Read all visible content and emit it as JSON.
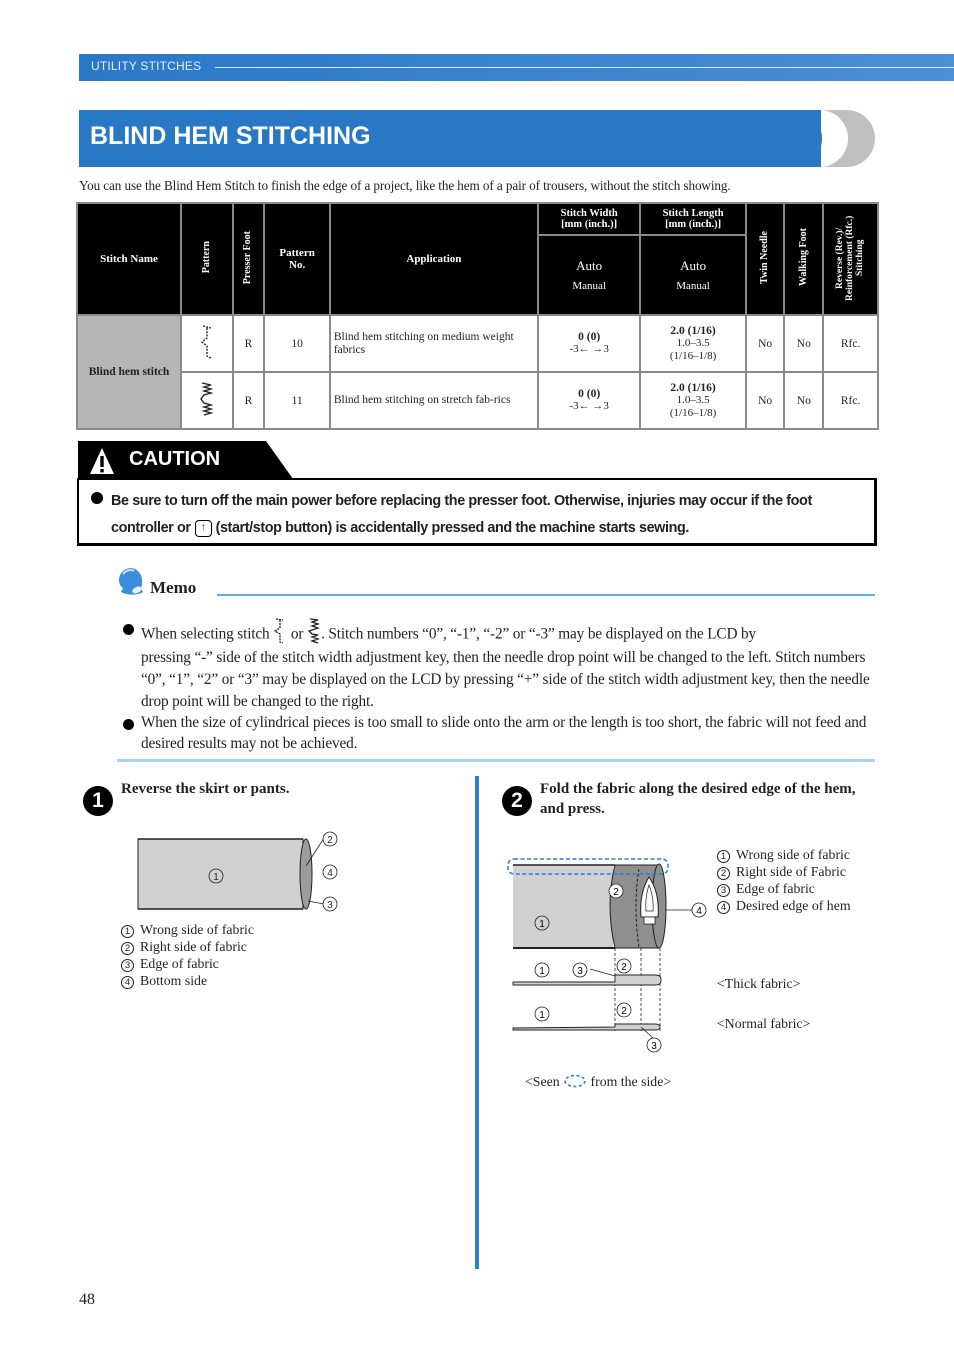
{
  "header": {
    "section_label": "UTILITY STITCHES",
    "page_title": "BLIND HEM STITCHING"
  },
  "intro": "You can use the Blind Hem Stitch to finish the edge of a project, like the hem of a pair of trousers, without the stitch showing.",
  "table": {
    "headers": {
      "stitch_name": "Stitch Name",
      "pattern": "Pattern",
      "presser_foot": "Presser Foot",
      "pattern_no": "Pattern No.",
      "application": "Application",
      "stitch_width": "Stitch Width [mm (inch.)]",
      "stitch_length": "Stitch Length [mm (inch.)]",
      "auto": "Auto",
      "manual": "Manual",
      "twin_needle": "Twin Needle",
      "walking_foot": "Walking Foot",
      "reverse": "Reverse (Rev.)/ Reinforcement (Rfc.) Stitching"
    },
    "group_name": "Blind hem stitch",
    "rows": [
      {
        "pattern_icon": "blind-hem-stitch-icon",
        "presser_foot": "R",
        "pattern_no": "10",
        "application": "Blind hem stitching on medium weight fabrics",
        "width_auto": "0 (0)",
        "width_manual": "-3← →3",
        "length_auto": "2.0 (1/16)",
        "length_manual": "1.0–3.5",
        "length_manual_inch": "(1/16–1/8)",
        "twin_needle": "No",
        "walking_foot": "No",
        "reverse": "Rfc."
      },
      {
        "pattern_icon": "stretch-blind-hem-stitch-icon",
        "presser_foot": "R",
        "pattern_no": "11",
        "application": "Blind hem stitching on stretch fab-rics",
        "width_auto": "0 (0)",
        "width_manual": "-3← →3",
        "length_auto": "2.0 (1/16)",
        "length_manual": "1.0–3.5",
        "length_manual_inch": "(1/16–1/8)",
        "twin_needle": "No",
        "walking_foot": "No",
        "reverse": "Rfc."
      }
    ]
  },
  "caution": {
    "title": "CAUTION",
    "text_before_icon": "Be sure to turn off the main power before replacing the presser foot. Otherwise, injuries may occur if the foot controller or",
    "icon": "start-stop-button-icon",
    "text_after_icon": "(start/stop button) is accidentally pressed and the machine starts sewing."
  },
  "memo": {
    "title": "Memo",
    "items": [
      {
        "before": "When selecting stitch",
        "middle": "or",
        "after": ". Stitch numbers “0”, “-1”, “-2” or “-3” may be displayed on the LCD by",
        "rest": "pressing “-” side of the stitch width adjustment key, then the needle drop point will be changed to the left. Stitch numbers “0”, “1”, “2” or “3” may be displayed on the LCD by pressing “+” side of the stitch width adjustment key, then the needle drop point will be changed to the right."
      },
      {
        "text": "When the size of cylindrical pieces is too small to slide onto the arm or the length is too short, the fabric will not feed and desired results may not be achieved."
      }
    ]
  },
  "steps": [
    {
      "number": "1",
      "text": "Reverse the skirt or pants.",
      "legend": [
        {
          "num": "1",
          "label": "Wrong side of fabric"
        },
        {
          "num": "2",
          "label": "Right side of fabric"
        },
        {
          "num": "3",
          "label": "Edge of fabric"
        },
        {
          "num": "4",
          "label": "Bottom side"
        }
      ]
    },
    {
      "number": "2",
      "text": "Fold the fabric along the desired edge of the hem, and press.",
      "legend": [
        {
          "num": "1",
          "label": "Wrong side of fabric"
        },
        {
          "num": "2",
          "label": "Right side of Fabric"
        },
        {
          "num": "3",
          "label": "Edge of fabric"
        },
        {
          "num": "4",
          "label": "Desired edge of hem"
        }
      ],
      "thick_label": "<Thick fabric>",
      "normal_label": "<Normal fabric>",
      "seen_before": "<Seen",
      "seen_after": "from the side>"
    }
  ],
  "callouts": {
    "c1": "1",
    "c2": "2",
    "c3": "3",
    "c4": "4"
  },
  "page_number": "48",
  "colors": {
    "brand_blue": "#2878c6",
    "memo_rule": "#5ab0ea",
    "table_header_bg": "#000000",
    "group_cell_bg": "#b5b5b5"
  }
}
